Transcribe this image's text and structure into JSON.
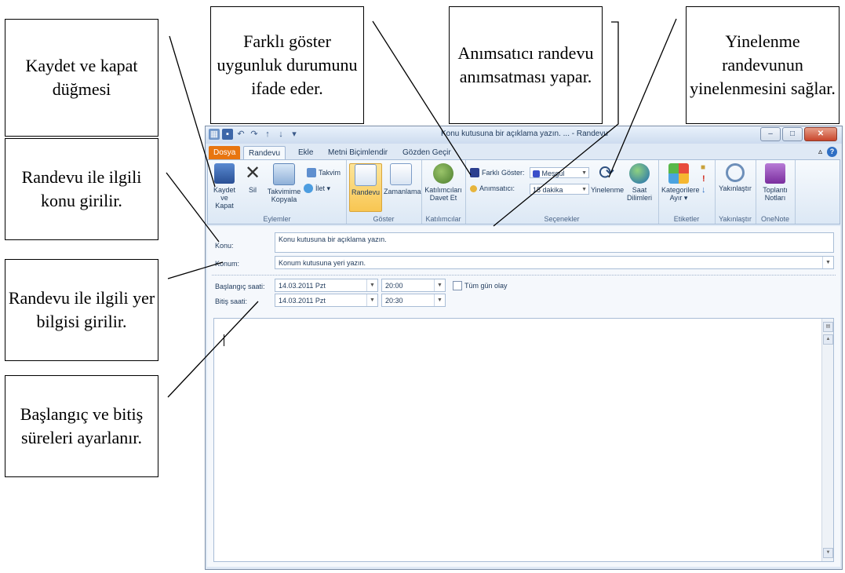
{
  "callouts": {
    "kaydet": "Kaydet ve kapat düğmesi",
    "farkli": "Farklı göster uygunluk durumunu ifade eder.",
    "animsatici": "Anımsatıcı randevu anımsatması yapar.",
    "yinelenme": "Yinelenme randevunun yinelenmesini sağlar.",
    "konu": "Randevu ile ilgili konu girilir.",
    "yer": "Randevu ile ilgili yer bilgisi girilir.",
    "sure": "Başlangıç ve bitiş süreleri ayarlanır."
  },
  "window": {
    "title": "Konu kutusuna bir açıklama yazın. ... - Randevu",
    "tabs": [
      "Dosya",
      "Randevu",
      "Ekle",
      "Metni Biçimlendir",
      "Gözden Geçir"
    ],
    "active_tab": "Randevu"
  },
  "ribbon": {
    "eylemler": {
      "label": "Eylemler",
      "kaydet": "Kaydet ve Kapat",
      "sil": "Sil",
      "kopyala": "Takvimime Kopyala",
      "takvim": "Takvim",
      "ilet": "İlet ▾"
    },
    "goster": {
      "label": "Göster",
      "randevu": "Randevu",
      "zamanlama": "Zamanlama"
    },
    "katilimcilar": {
      "label": "Katılımcılar",
      "davet": "Katılımcıları Davet Et"
    },
    "secenekler": {
      "label": "Seçenekler",
      "farkli_label": "Farklı Göster:",
      "farkli_value": "Meşgul",
      "animsatici_label": "Anımsatıcı:",
      "animsatici_value": "15 dakika",
      "yinelenme": "Yinelenme",
      "saat": "Saat Dilimleri"
    },
    "etiketler": {
      "label": "Etiketler",
      "kategori": "Kategorilere Ayır ▾"
    },
    "yakinlastir": {
      "label": "Yakınlaştır",
      "btn": "Yakınlaştır"
    },
    "onenote": {
      "label": "OneNote",
      "btn": "Toplantı Notları"
    }
  },
  "form": {
    "konu_label": "Konu:",
    "konu_value": "Konu kutusuna bir açıklama yazın.",
    "konum_label": "Konum:",
    "konum_value": "Konum kutusuna yeri yazın.",
    "baslangic_label": "Başlangıç saati:",
    "baslangic_date": "14.03.2011 Pzt",
    "baslangic_time": "20:00",
    "bitis_label": "Bitiş saati:",
    "bitis_date": "14.03.2011 Pzt",
    "bitis_time": "20:30",
    "tum_gun": "Tüm gün olay"
  },
  "colors": {
    "file_tab": "#e8750f",
    "busy": "#3b4fc9",
    "ribbon": "#dce8f5"
  }
}
